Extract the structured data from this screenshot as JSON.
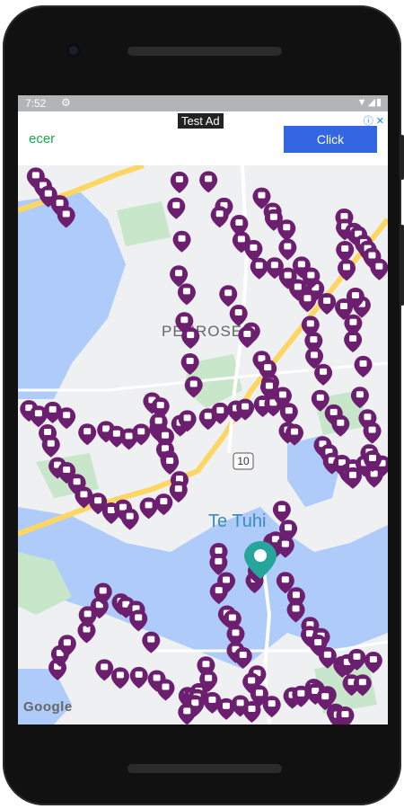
{
  "status_bar": {
    "time": "7:52",
    "settings_icon": "gear-icon",
    "wifi_icon": "wifi-icon",
    "signal_icon": "signal-icon",
    "battery_icon": "battery-icon"
  },
  "ad": {
    "label": "Test Ad",
    "brand": "ecer",
    "cta": "Click",
    "info_icon": "ad-info-icon",
    "close_icon": "close-icon"
  },
  "map": {
    "place_labels": [
      "PENROSE",
      "Te Tuhi"
    ],
    "road_shield": "10",
    "attribution": "Google",
    "pin_color": "#6b1f6e",
    "water_color": "#aecbfa",
    "park_color": "#c8e6c9",
    "road_color": "#fdd663"
  },
  "location_marker": "location-pin-icon"
}
